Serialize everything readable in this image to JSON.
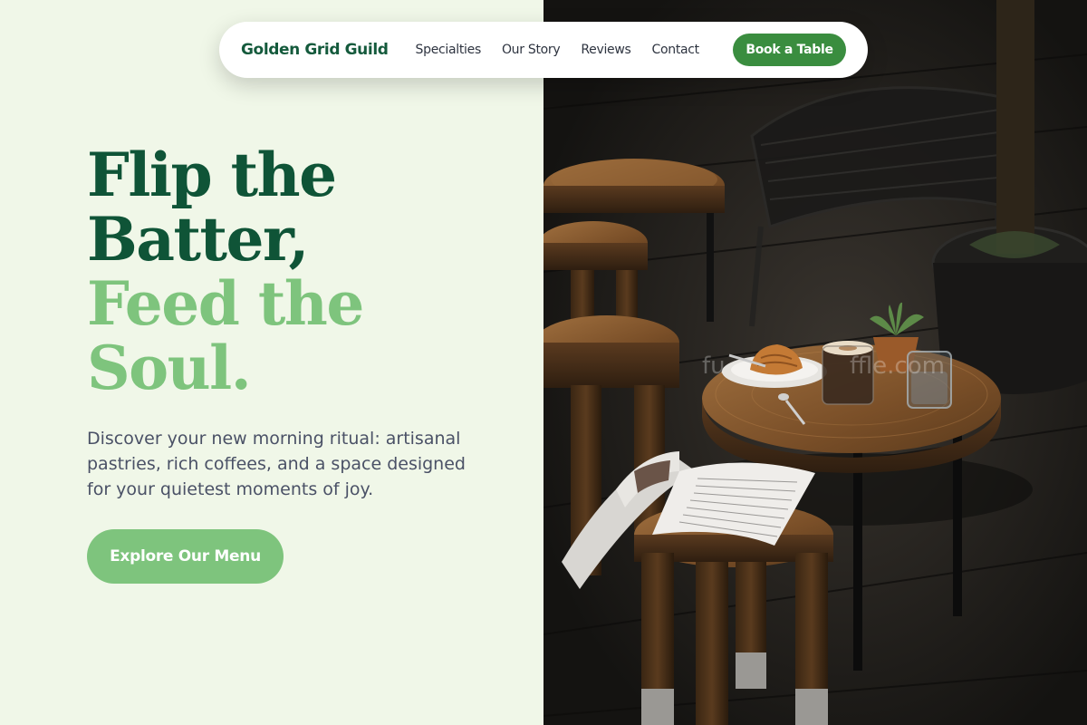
{
  "nav": {
    "brand": "Golden Grid Guild",
    "links": [
      "Specialties",
      "Our Story",
      "Reviews",
      "Contact"
    ],
    "cta_label": "Book a Table"
  },
  "hero": {
    "headline_dark": [
      "Flip the",
      "Batter,"
    ],
    "headline_light": [
      "Feed the",
      "Soul."
    ],
    "description": "Discover your new morning ritual: artisanal pastries, rich coffees, and a space designed for your quietest moments of joy.",
    "cta_label": "Explore Our Menu"
  },
  "photo": {
    "alt": "Café table with croissant, latte and open magazine on a dark wooden terrace",
    "watermark": "fu",
    "watermark_end": "ffle.com"
  },
  "colors": {
    "background": "#f0f7e8",
    "headline_dark": "#0f5437",
    "headline_light": "#7ec47d",
    "body_text": "#4a5166",
    "cta_primary": "#7ec47d",
    "nav_button": "#3a8d3f"
  }
}
